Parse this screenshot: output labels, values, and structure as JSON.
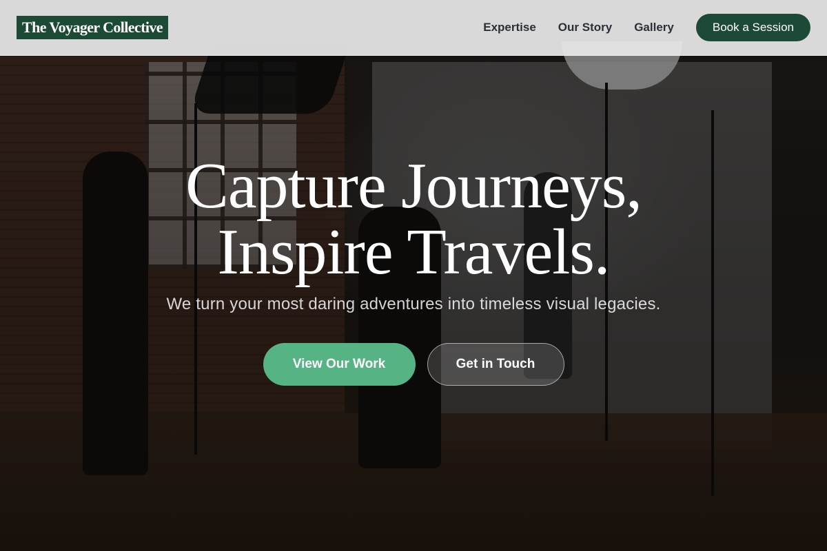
{
  "header": {
    "logo": "The Voyager Collective",
    "nav": [
      {
        "label": "Expertise"
      },
      {
        "label": "Our Story"
      },
      {
        "label": "Gallery"
      }
    ],
    "cta_label": "Book a Session"
  },
  "hero": {
    "title_line1": "Capture Journeys,",
    "title_line2": "Inspire Travels.",
    "subtitle": "We turn your most daring adventures into timeless visual legacies.",
    "primary_button": "View Our Work",
    "secondary_button": "Get in Touch"
  },
  "colors": {
    "brand_green": "#1d4a36",
    "accent_green": "#55b384",
    "header_bg": "#e8e8e8"
  }
}
